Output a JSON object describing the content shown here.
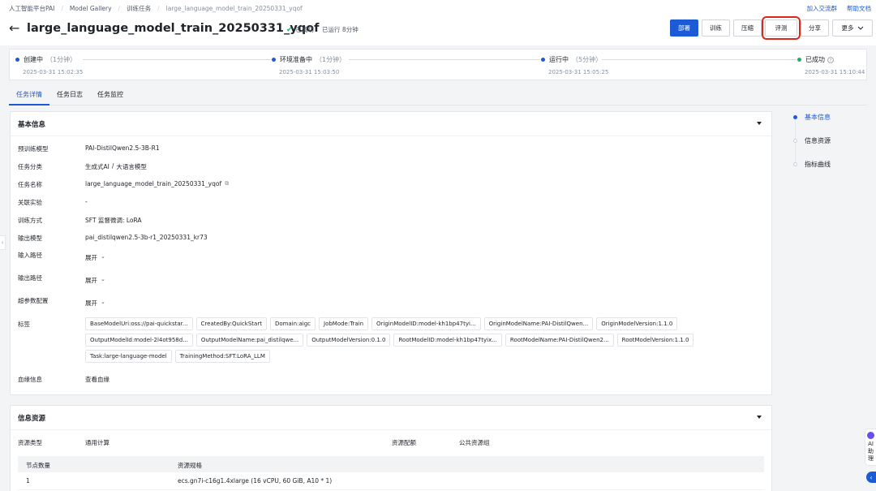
{
  "breadcrumb": {
    "items": [
      "人工智能平台PAI",
      "Model Gallery",
      "训练任务",
      "large_language_model_train_20250331_yqof"
    ]
  },
  "top_links": {
    "community": "加入交流群",
    "docs": "帮助文档"
  },
  "header": {
    "back": "←",
    "title": "large_language_model_train_20250331_yqof",
    "status": "已成功",
    "status_icon": "✔",
    "running": "已运行 8分钟",
    "buttons": {
      "deploy": "部署",
      "train": "训练",
      "compress": "压缩",
      "evaluate": "评测",
      "share": "分享",
      "more": "更多"
    }
  },
  "progress": {
    "steps": [
      {
        "label": "创建中",
        "duration": "（1分钟）",
        "time": "2025-03-31 15:02:35"
      },
      {
        "label": "环境准备中",
        "duration": "（1分钟）",
        "time": "2025-03-31 15:03:50"
      },
      {
        "label": "运行中",
        "duration": "（5分钟）",
        "time": "2025-03-31 15:05:25"
      },
      {
        "label": "已成功",
        "duration": "",
        "time": "2025-03-31 15:10:44"
      }
    ]
  },
  "tabs": [
    "任务详情",
    "任务日志",
    "任务监控"
  ],
  "basic_info": {
    "title": "基本信息",
    "fields": {
      "pretrained_model": {
        "label": "预训练模型",
        "value": "PAI-DistilQwen2.5-3B-R1"
      },
      "category": {
        "label": "任务分类",
        "value_a": "生成式AI",
        "divider": "/",
        "value_b": "大语言模型"
      },
      "task_name": {
        "label": "任务名称",
        "value": "large_language_model_train_20250331_yqof"
      },
      "experiment": {
        "label": "关联实验",
        "value": "-"
      },
      "training_method": {
        "label": "训练方式",
        "value": "SFT 监督微调: LoRA"
      },
      "output_model": {
        "label": "输出模型",
        "value": "pai_distilqwen2.5-3b-r1_20250331_kr73"
      },
      "input_path": {
        "label": "输入路径",
        "value": "展开"
      },
      "output_path": {
        "label": "输出路径",
        "value": "展开"
      },
      "hyperparams": {
        "label": "超参数配置",
        "value": "展开"
      },
      "tags_label": "标签",
      "lineage": {
        "label": "血缘信息",
        "value": "查看血缘"
      }
    },
    "tags": [
      "BaseModelUri:oss://pai-quickstar...",
      "CreatedBy:QuickStart",
      "Domain:aigc",
      "JobMode:Train",
      "OriginModelID:model-kh1bp47tyi...",
      "OriginModelName:PAI-DistilQwen...",
      "OriginModelVersion:1.1.0",
      "OutputModelId:model-2l4ot958d...",
      "OutputModelName:pai_distilqwe...",
      "OutputModelVersion:0.1.0",
      "RootModelID:model-kh1bp47tyix...",
      "RootModelName:PAI-DistilQwen2...",
      "RootModelVersion:1.1.0",
      "Task:large-language-model",
      "TrainingMethod:SFT:LoRA_LLM"
    ]
  },
  "resources": {
    "title": "信息资源",
    "type_label": "资源类型",
    "type_value": "通用计算",
    "quota_label": "资源配额",
    "quota_value": "公共资源组",
    "columns": [
      "节点数量",
      "资源规格"
    ],
    "rows": [
      {
        "nodes": "1",
        "spec": "ecs.gn7i-c16g1.4xlarge (16 vCPU, 60 GiB, A10 * 1)"
      }
    ]
  },
  "anchor_nav": [
    "基本信息",
    "信息资源",
    "指标曲线"
  ],
  "ai_widget": {
    "line1": "AI",
    "line2": "助",
    "line3": "理"
  }
}
